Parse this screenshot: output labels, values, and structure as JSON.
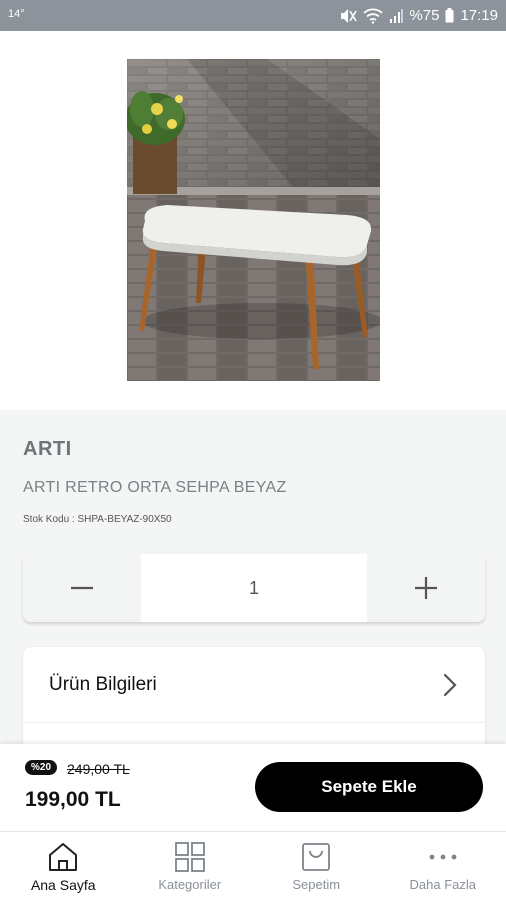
{
  "status_bar": {
    "left_text": "14°",
    "battery": "%75",
    "time": "17:19"
  },
  "product": {
    "brand": "ARTI",
    "title": "ARTI RETRO ORTA SEHPA BEYAZ",
    "sku_label": "Stok Kodu : SHPA-BEYAZ-90X50",
    "image_icon": "coffee-table-photo"
  },
  "quantity": {
    "value": "1"
  },
  "details": {
    "product_info_label": "Ürün Bilgileri"
  },
  "purchase": {
    "discount_badge": "%20",
    "old_price": "249,00 TL",
    "price": "199,00 TL",
    "add_to_cart_label": "Sepete Ekle"
  },
  "tabbar": {
    "items": [
      {
        "label": "Ana Sayfa",
        "icon": "home-icon",
        "active": true
      },
      {
        "label": "Kategoriler",
        "icon": "grid-icon",
        "active": false
      },
      {
        "label": "Sepetim",
        "icon": "bag-icon",
        "active": false
      },
      {
        "label": "Daha Fazla",
        "icon": "more-icon",
        "active": false
      }
    ]
  },
  "colors": {
    "status_bar": "#8d939a",
    "background": "#f4f5f5",
    "primary_button": "#000000",
    "muted_text": "#7b8186"
  }
}
